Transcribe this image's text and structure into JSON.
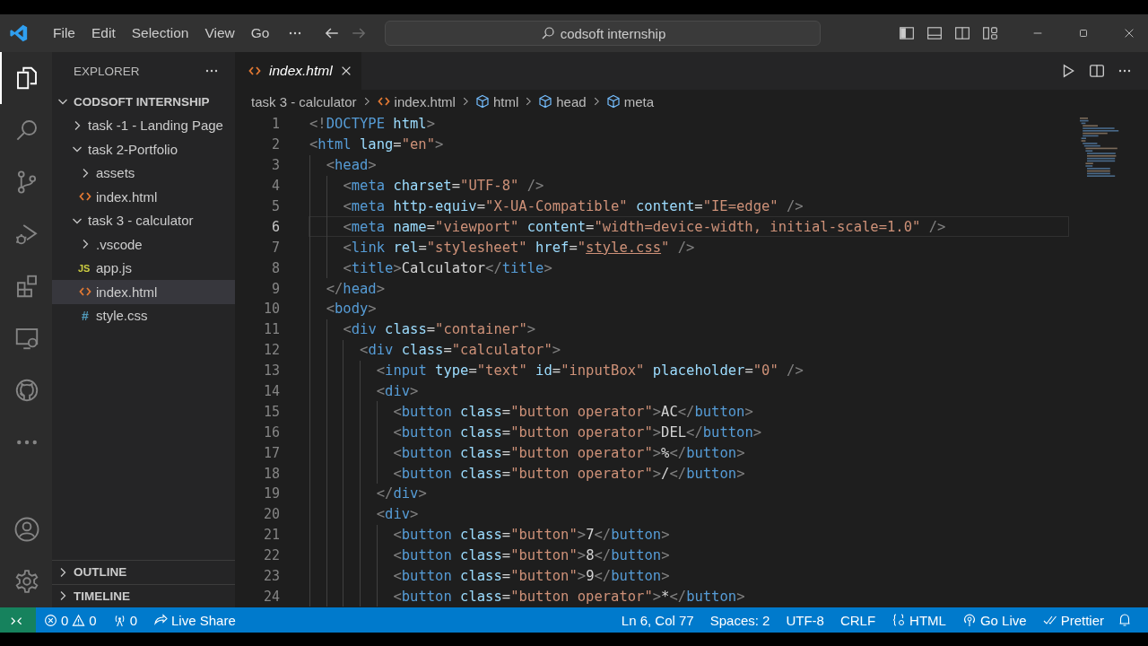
{
  "title_bar": {
    "menu": [
      "File",
      "Edit",
      "Selection",
      "View",
      "Go"
    ],
    "search": "codsoft internship"
  },
  "activity_bar": {
    "top": [
      {
        "kind": "explorer",
        "selected": true
      },
      {
        "kind": "search",
        "selected": false
      },
      {
        "kind": "scm",
        "selected": false
      },
      {
        "kind": "debug",
        "selected": false
      },
      {
        "kind": "extensions",
        "selected": false
      },
      {
        "kind": "remote",
        "selected": false
      },
      {
        "kind": "github",
        "selected": false
      },
      {
        "kind": "more",
        "selected": false
      }
    ],
    "bottom": [
      {
        "kind": "accounts"
      },
      {
        "kind": "settings"
      }
    ]
  },
  "sidebar": {
    "title": "EXPLORER",
    "root": {
      "label": "CODSOFT INTERNSHIP",
      "expanded": true,
      "children": [
        {
          "label": "task -1 - Landing Page",
          "kind": "folder",
          "expanded": false,
          "selected": false
        },
        {
          "label": "task 2-Portfolio",
          "kind": "folder",
          "expanded": true,
          "selected": false,
          "children": [
            {
              "label": "assets",
              "kind": "folder",
              "expanded": false,
              "selected": false
            },
            {
              "label": "index.html",
              "kind": "html",
              "selected": false
            }
          ]
        },
        {
          "label": "task 3 - calculator",
          "kind": "folder",
          "expanded": true,
          "selected": false,
          "children": [
            {
              "label": ".vscode",
              "kind": "folder",
              "expanded": false,
              "selected": false
            },
            {
              "label": "app.js",
              "kind": "js",
              "icon_text": "JS",
              "selected": false
            },
            {
              "label": "index.html",
              "kind": "html",
              "selected": true
            },
            {
              "label": "style.css",
              "kind": "css",
              "icon_text": "#",
              "selected": false
            }
          ]
        }
      ]
    },
    "sections": [
      {
        "label": "OUTLINE",
        "expanded": false
      },
      {
        "label": "TIMELINE",
        "expanded": false
      }
    ]
  },
  "tabs": [
    {
      "label": "index.html",
      "kind": "html",
      "selected": true,
      "preview": true
    }
  ],
  "breadcrumbs": [
    {
      "label": "task 3 - calculator",
      "kind": "folder"
    },
    {
      "label": "index.html",
      "kind": "html"
    },
    {
      "label": "html",
      "kind": "element"
    },
    {
      "label": "head",
      "kind": "element"
    },
    {
      "label": "meta",
      "kind": "element"
    }
  ],
  "editor": {
    "lines": [
      {
        "number": "1",
        "current": false,
        "tokens": [
          {
            "kind": "punct",
            "text": "<!"
          },
          {
            "kind": "tag",
            "text": "DOCTYPE"
          },
          {
            "kind": "attr",
            "text": " html"
          },
          {
            "kind": "punct",
            "text": ">"
          }
        ]
      },
      {
        "number": "2",
        "current": false,
        "tokens": [
          {
            "kind": "punct",
            "text": "<"
          },
          {
            "kind": "tag",
            "text": "html"
          },
          {
            "kind": "attr",
            "text": " lang"
          },
          {
            "kind": "eq",
            "text": "="
          },
          {
            "kind": "str",
            "text": "\"en\""
          },
          {
            "kind": "punct",
            "text": ">"
          }
        ]
      },
      {
        "number": "3",
        "current": false,
        "tokens": [
          {
            "kind": "punct",
            "text": "  <"
          },
          {
            "kind": "tag",
            "text": "head"
          },
          {
            "kind": "punct",
            "text": ">"
          }
        ]
      },
      {
        "number": "4",
        "current": false,
        "tokens": [
          {
            "kind": "punct",
            "text": "    <"
          },
          {
            "kind": "tag",
            "text": "meta"
          },
          {
            "kind": "attr",
            "text": " charset"
          },
          {
            "kind": "eq",
            "text": "="
          },
          {
            "kind": "str",
            "text": "\"UTF-8\""
          },
          {
            "kind": "punct",
            "text": " />"
          }
        ]
      },
      {
        "number": "5",
        "current": false,
        "tokens": [
          {
            "kind": "punct",
            "text": "    <"
          },
          {
            "kind": "tag",
            "text": "meta"
          },
          {
            "kind": "attr",
            "text": " http-equiv"
          },
          {
            "kind": "eq",
            "text": "="
          },
          {
            "kind": "str",
            "text": "\"X-UA-Compatible\""
          },
          {
            "kind": "attr",
            "text": " content"
          },
          {
            "kind": "eq",
            "text": "="
          },
          {
            "kind": "str",
            "text": "\"IE=edge\""
          },
          {
            "kind": "punct",
            "text": " />"
          }
        ]
      },
      {
        "number": "6",
        "current": true,
        "tokens": [
          {
            "kind": "punct",
            "text": "    <"
          },
          {
            "kind": "tag",
            "text": "meta"
          },
          {
            "kind": "attr",
            "text": " name"
          },
          {
            "kind": "eq",
            "text": "="
          },
          {
            "kind": "str",
            "text": "\"viewport\""
          },
          {
            "kind": "attr",
            "text": " content"
          },
          {
            "kind": "eq",
            "text": "="
          },
          {
            "kind": "str",
            "text": "\"width=device-width, initial-scale=1.0\""
          },
          {
            "kind": "punct",
            "text": " />"
          }
        ]
      },
      {
        "number": "7",
        "current": false,
        "tokens": [
          {
            "kind": "punct",
            "text": "    <"
          },
          {
            "kind": "tag",
            "text": "link"
          },
          {
            "kind": "attr",
            "text": " rel"
          },
          {
            "kind": "eq",
            "text": "="
          },
          {
            "kind": "str",
            "text": "\"stylesheet\""
          },
          {
            "kind": "attr",
            "text": " href"
          },
          {
            "kind": "eq",
            "text": "="
          },
          {
            "kind": "str",
            "text": "\""
          },
          {
            "kind": "link",
            "text": "style.css"
          },
          {
            "kind": "str",
            "text": "\""
          },
          {
            "kind": "punct",
            "text": " />"
          }
        ]
      },
      {
        "number": "8",
        "current": false,
        "tokens": [
          {
            "kind": "punct",
            "text": "    <"
          },
          {
            "kind": "tag",
            "text": "title"
          },
          {
            "kind": "punct",
            "text": ">"
          },
          {
            "kind": "text",
            "text": "Calculator"
          },
          {
            "kind": "punct",
            "text": "</"
          },
          {
            "kind": "tag",
            "text": "title"
          },
          {
            "kind": "punct",
            "text": ">"
          }
        ]
      },
      {
        "number": "9",
        "current": false,
        "tokens": [
          {
            "kind": "punct",
            "text": "  </"
          },
          {
            "kind": "tag",
            "text": "head"
          },
          {
            "kind": "punct",
            "text": ">"
          }
        ]
      },
      {
        "number": "10",
        "current": false,
        "tokens": [
          {
            "kind": "punct",
            "text": "  <"
          },
          {
            "kind": "tag",
            "text": "body"
          },
          {
            "kind": "punct",
            "text": ">"
          }
        ]
      },
      {
        "number": "11",
        "current": false,
        "tokens": [
          {
            "kind": "punct",
            "text": "    <"
          },
          {
            "kind": "tag",
            "text": "div"
          },
          {
            "kind": "attr",
            "text": " class"
          },
          {
            "kind": "eq",
            "text": "="
          },
          {
            "kind": "str",
            "text": "\"container\""
          },
          {
            "kind": "punct",
            "text": ">"
          }
        ]
      },
      {
        "number": "12",
        "current": false,
        "tokens": [
          {
            "kind": "punct",
            "text": "      <"
          },
          {
            "kind": "tag",
            "text": "div"
          },
          {
            "kind": "attr",
            "text": " class"
          },
          {
            "kind": "eq",
            "text": "="
          },
          {
            "kind": "str",
            "text": "\"calculator\""
          },
          {
            "kind": "punct",
            "text": ">"
          }
        ]
      },
      {
        "number": "13",
        "current": false,
        "tokens": [
          {
            "kind": "punct",
            "text": "        <"
          },
          {
            "kind": "tag",
            "text": "input"
          },
          {
            "kind": "attr",
            "text": " type"
          },
          {
            "kind": "eq",
            "text": "="
          },
          {
            "kind": "str",
            "text": "\"text\""
          },
          {
            "kind": "attr",
            "text": " id"
          },
          {
            "kind": "eq",
            "text": "="
          },
          {
            "kind": "str",
            "text": "\"inputBox\""
          },
          {
            "kind": "attr",
            "text": " placeholder"
          },
          {
            "kind": "eq",
            "text": "="
          },
          {
            "kind": "str",
            "text": "\"0\""
          },
          {
            "kind": "punct",
            "text": " />"
          }
        ]
      },
      {
        "number": "14",
        "current": false,
        "tokens": [
          {
            "kind": "punct",
            "text": "        <"
          },
          {
            "kind": "tag",
            "text": "div"
          },
          {
            "kind": "punct",
            "text": ">"
          }
        ]
      },
      {
        "number": "15",
        "current": false,
        "tokens": [
          {
            "kind": "punct",
            "text": "          <"
          },
          {
            "kind": "tag",
            "text": "button"
          },
          {
            "kind": "attr",
            "text": " class"
          },
          {
            "kind": "eq",
            "text": "="
          },
          {
            "kind": "str",
            "text": "\"button operator\""
          },
          {
            "kind": "punct",
            "text": ">"
          },
          {
            "kind": "text",
            "text": "AC"
          },
          {
            "kind": "punct",
            "text": "</"
          },
          {
            "kind": "tag",
            "text": "button"
          },
          {
            "kind": "punct",
            "text": ">"
          }
        ]
      },
      {
        "number": "16",
        "current": false,
        "tokens": [
          {
            "kind": "punct",
            "text": "          <"
          },
          {
            "kind": "tag",
            "text": "button"
          },
          {
            "kind": "attr",
            "text": " class"
          },
          {
            "kind": "eq",
            "text": "="
          },
          {
            "kind": "str",
            "text": "\"button operator\""
          },
          {
            "kind": "punct",
            "text": ">"
          },
          {
            "kind": "text",
            "text": "DEL"
          },
          {
            "kind": "punct",
            "text": "</"
          },
          {
            "kind": "tag",
            "text": "button"
          },
          {
            "kind": "punct",
            "text": ">"
          }
        ]
      },
      {
        "number": "17",
        "current": false,
        "tokens": [
          {
            "kind": "punct",
            "text": "          <"
          },
          {
            "kind": "tag",
            "text": "button"
          },
          {
            "kind": "attr",
            "text": " class"
          },
          {
            "kind": "eq",
            "text": "="
          },
          {
            "kind": "str",
            "text": "\"button operator\""
          },
          {
            "kind": "punct",
            "text": ">"
          },
          {
            "kind": "text",
            "text": "%"
          },
          {
            "kind": "punct",
            "text": "</"
          },
          {
            "kind": "tag",
            "text": "button"
          },
          {
            "kind": "punct",
            "text": ">"
          }
        ]
      },
      {
        "number": "18",
        "current": false,
        "tokens": [
          {
            "kind": "punct",
            "text": "          <"
          },
          {
            "kind": "tag",
            "text": "button"
          },
          {
            "kind": "attr",
            "text": " class"
          },
          {
            "kind": "eq",
            "text": "="
          },
          {
            "kind": "str",
            "text": "\"button operator\""
          },
          {
            "kind": "punct",
            "text": ">"
          },
          {
            "kind": "text",
            "text": "/"
          },
          {
            "kind": "punct",
            "text": "</"
          },
          {
            "kind": "tag",
            "text": "button"
          },
          {
            "kind": "punct",
            "text": ">"
          }
        ]
      },
      {
        "number": "19",
        "current": false,
        "tokens": [
          {
            "kind": "punct",
            "text": "        </"
          },
          {
            "kind": "tag",
            "text": "div"
          },
          {
            "kind": "punct",
            "text": ">"
          }
        ]
      },
      {
        "number": "20",
        "current": false,
        "tokens": [
          {
            "kind": "punct",
            "text": "        <"
          },
          {
            "kind": "tag",
            "text": "div"
          },
          {
            "kind": "punct",
            "text": ">"
          }
        ]
      },
      {
        "number": "21",
        "current": false,
        "tokens": [
          {
            "kind": "punct",
            "text": "          <"
          },
          {
            "kind": "tag",
            "text": "button"
          },
          {
            "kind": "attr",
            "text": " class"
          },
          {
            "kind": "eq",
            "text": "="
          },
          {
            "kind": "str",
            "text": "\"button\""
          },
          {
            "kind": "punct",
            "text": ">"
          },
          {
            "kind": "text",
            "text": "7"
          },
          {
            "kind": "punct",
            "text": "</"
          },
          {
            "kind": "tag",
            "text": "button"
          },
          {
            "kind": "punct",
            "text": ">"
          }
        ]
      },
      {
        "number": "22",
        "current": false,
        "tokens": [
          {
            "kind": "punct",
            "text": "          <"
          },
          {
            "kind": "tag",
            "text": "button"
          },
          {
            "kind": "attr",
            "text": " class"
          },
          {
            "kind": "eq",
            "text": "="
          },
          {
            "kind": "str",
            "text": "\"button\""
          },
          {
            "kind": "punct",
            "text": ">"
          },
          {
            "kind": "text",
            "text": "8"
          },
          {
            "kind": "punct",
            "text": "</"
          },
          {
            "kind": "tag",
            "text": "button"
          },
          {
            "kind": "punct",
            "text": ">"
          }
        ]
      },
      {
        "number": "23",
        "current": false,
        "tokens": [
          {
            "kind": "punct",
            "text": "          <"
          },
          {
            "kind": "tag",
            "text": "button"
          },
          {
            "kind": "attr",
            "text": " class"
          },
          {
            "kind": "eq",
            "text": "="
          },
          {
            "kind": "str",
            "text": "\"button\""
          },
          {
            "kind": "punct",
            "text": ">"
          },
          {
            "kind": "text",
            "text": "9"
          },
          {
            "kind": "punct",
            "text": "</"
          },
          {
            "kind": "tag",
            "text": "button"
          },
          {
            "kind": "punct",
            "text": ">"
          }
        ]
      },
      {
        "number": "24",
        "current": false,
        "tokens": [
          {
            "kind": "punct",
            "text": "          <"
          },
          {
            "kind": "tag",
            "text": "button"
          },
          {
            "kind": "attr",
            "text": " class"
          },
          {
            "kind": "eq",
            "text": "="
          },
          {
            "kind": "str",
            "text": "\"button operator\""
          },
          {
            "kind": "punct",
            "text": ">"
          },
          {
            "kind": "text",
            "text": "*"
          },
          {
            "kind": "punct",
            "text": "</"
          },
          {
            "kind": "tag",
            "text": "button"
          },
          {
            "kind": "punct",
            "text": ">"
          }
        ]
      }
    ]
  },
  "status_bar": {
    "left": [
      {
        "kind": "remote"
      },
      {
        "kind": "problems",
        "errors": "0",
        "warnings": "0"
      },
      {
        "kind": "ports",
        "text": "0"
      },
      {
        "kind": "live-share",
        "text": "Live Share"
      }
    ],
    "right": [
      {
        "kind": "plain",
        "text": "Ln 6, Col 77"
      },
      {
        "kind": "plain",
        "text": "Spaces: 2"
      },
      {
        "kind": "plain",
        "text": "UTF-8"
      },
      {
        "kind": "plain",
        "text": "CRLF"
      },
      {
        "kind": "language",
        "text": "HTML"
      },
      {
        "kind": "go-live",
        "text": "Go Live"
      },
      {
        "kind": "prettier",
        "text": "Prettier"
      },
      {
        "kind": "bell"
      }
    ]
  }
}
